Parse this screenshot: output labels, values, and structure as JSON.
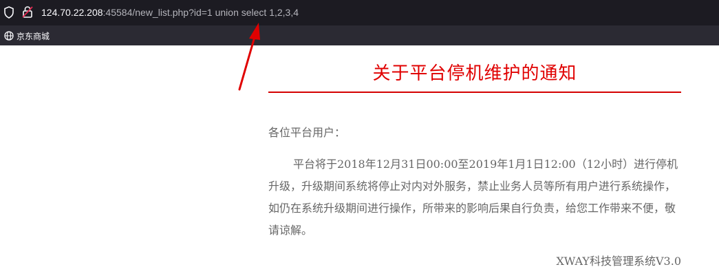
{
  "browser": {
    "url_host": "124.70.22.208",
    "url_rest": ":45584/new_list.php?id=1 union select 1,2,3,4",
    "bookmarks": [
      {
        "label": "京东商城",
        "icon": "globe-icon"
      }
    ]
  },
  "notice": {
    "title": "关于平台停机维护的通知",
    "greeting": "各位平台用户：",
    "body": "平台将于2018年12月31日00:00至2019年1月1日12:00（12小时）进行停机升级，升级期间系统将停止对内对外服务，禁止业务人员等所有用户进行系统操作，如仍在系统升级期间进行操作，所带来的影响后果自行负责，给您工作带来不便，敬请谅解。",
    "signature": "XWAY科技管理系统V3.0"
  },
  "colors": {
    "title_red": "#e00000",
    "rule_red": "#d40000",
    "annotation_red": "#e00000",
    "body_gray": "#666666"
  }
}
